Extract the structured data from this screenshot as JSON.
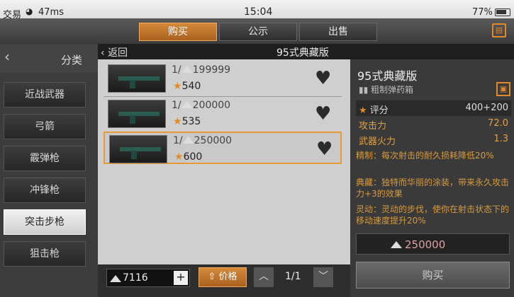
{
  "status": {
    "carrier": "交易",
    "speed": "47ms",
    "time": "15:04",
    "battery": "77%"
  },
  "tabs": [
    {
      "label": "购买"
    },
    {
      "label": "公示"
    },
    {
      "label": "出售"
    }
  ],
  "sidebar": {
    "title": "分类",
    "items": [
      {
        "label": "近战武器"
      },
      {
        "label": "弓箭"
      },
      {
        "label": "霰弹枪"
      },
      {
        "label": "冲锋枪"
      },
      {
        "label": "突击步枪"
      },
      {
        "label": "狙击枪"
      }
    ]
  },
  "header": {
    "back": "返回",
    "title": "95式典藏版"
  },
  "listings": [
    {
      "qty": "1/",
      "price": "199999",
      "rating": "540"
    },
    {
      "qty": "1/",
      "price": "200000",
      "rating": "535"
    },
    {
      "qty": "1/",
      "price": "250000",
      "rating": "600"
    }
  ],
  "bottom": {
    "money": "7116",
    "sort_label": "价格",
    "page": "1/1"
  },
  "detail": {
    "name": "95式典藏版",
    "sub": "粗制弹药箱",
    "stats": [
      {
        "k": "评分",
        "v": "400+200"
      },
      {
        "k": "攻击力",
        "v": "72.0"
      },
      {
        "k": "武器火力",
        "v": "1.3"
      }
    ],
    "desc": [
      "精制：每次射击的耐久损耗降低20%",
      "典藏：独特而华丽的涂装，带来永久攻击力+3的效果",
      "灵动：灵动的步伐，使你在射击状态下的移动速度提升20%"
    ],
    "price": "250000",
    "buy_label": "购买"
  }
}
